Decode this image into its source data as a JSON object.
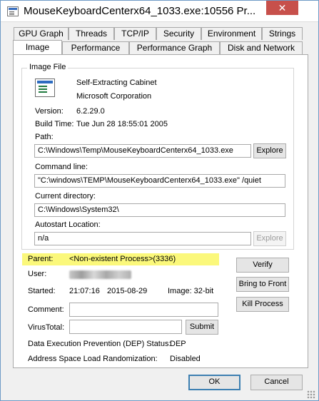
{
  "window": {
    "title": "MouseKeyboardCenterx64_1033.exe:10556 Pr...",
    "close_glyph": "✕"
  },
  "tabs": {
    "row1": [
      "GPU Graph",
      "Threads",
      "TCP/IP",
      "Security",
      "Environment",
      "Strings"
    ],
    "row2": [
      "Image",
      "Performance",
      "Performance Graph",
      "Disk and Network"
    ],
    "active": "Image"
  },
  "image_file": {
    "legend": "Image File",
    "icon": "executable-file-icon",
    "description": "Self-Extracting Cabinet",
    "company": "Microsoft Corporation",
    "version_label": "Version:",
    "version": "6.2.29.0",
    "build_time_label": "Build Time:",
    "build_time": "Tue Jun 28 18:55:01 2005",
    "path_label": "Path:",
    "path": "C:\\Windows\\Temp\\MouseKeyboardCenterx64_1033.exe",
    "explore_label": "Explore",
    "command_line_label": "Command line:",
    "command_line": "\"C:\\windows\\TEMP\\MouseKeyboardCenterx64_1033.exe\" /quiet",
    "current_dir_label": "Current directory:",
    "current_dir": "C:\\Windows\\System32\\",
    "autostart_label": "Autostart Location:",
    "autostart": "n/a",
    "autostart_explore_label": "Explore"
  },
  "process": {
    "parent_label": "Parent:",
    "parent": "<Non-existent Process>(3336)",
    "user_label": "User:",
    "started_label": "Started:",
    "started_time": "21:07:16",
    "started_date": "2015-08-29",
    "image_bits": "Image: 32-bit",
    "comment_label": "Comment:",
    "comment": "",
    "virustotal_label": "VirusTotal:",
    "virustotal": "",
    "submit_label": "Submit",
    "dep_label": "Data Execution Prevention (DEP) Status:",
    "dep_value": "DEP",
    "aslr_label": "Address Space Load Randomization:",
    "aslr_value": "Disabled",
    "highlight_color": "#fbf87b"
  },
  "actions": {
    "verify_label": "Verify",
    "bring_to_front_label": "Bring to Front",
    "kill_process_label": "Kill Process"
  },
  "footer": {
    "ok_label": "OK",
    "cancel_label": "Cancel"
  }
}
